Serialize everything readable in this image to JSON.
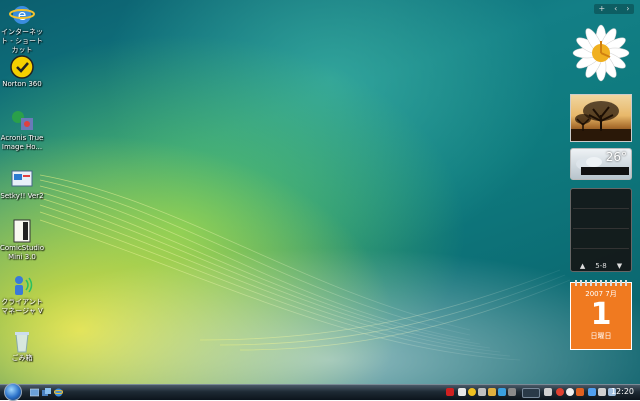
{
  "desktop_icons": [
    {
      "id": "ie",
      "label": "インターネット - ショートカット",
      "icon": "internet-explorer-icon"
    },
    {
      "id": "norton",
      "label": "Norton 360",
      "icon": "norton-icon"
    },
    {
      "id": "acronis",
      "label": "Acronis True Image Ho...",
      "icon": "acronis-icon"
    },
    {
      "id": "setky",
      "label": "Setky!! Ver2",
      "icon": "setky-icon"
    },
    {
      "id": "comicstudio",
      "label": "ComicStudio Mini 3.0",
      "icon": "comicstudio-icon"
    },
    {
      "id": "client",
      "label": "クライアント マネージャ V",
      "icon": "client-manager-icon"
    },
    {
      "id": "recycle",
      "label": "ごみ箱",
      "icon": "recycle-bin-icon"
    }
  ],
  "sidebar": {
    "controls": [
      "+",
      "‹",
      "›"
    ],
    "weather": {
      "temp": "26°"
    },
    "feeds": {
      "page": "5-8",
      "prev": "▲",
      "next": "▼"
    },
    "calendar": {
      "month": "2007 7月",
      "day": "1",
      "weekday": "日曜日"
    }
  },
  "taskbar": {
    "time": "12:20"
  },
  "colors": {
    "taskbar": "#1e2a34",
    "calendar": "#f07a20"
  }
}
